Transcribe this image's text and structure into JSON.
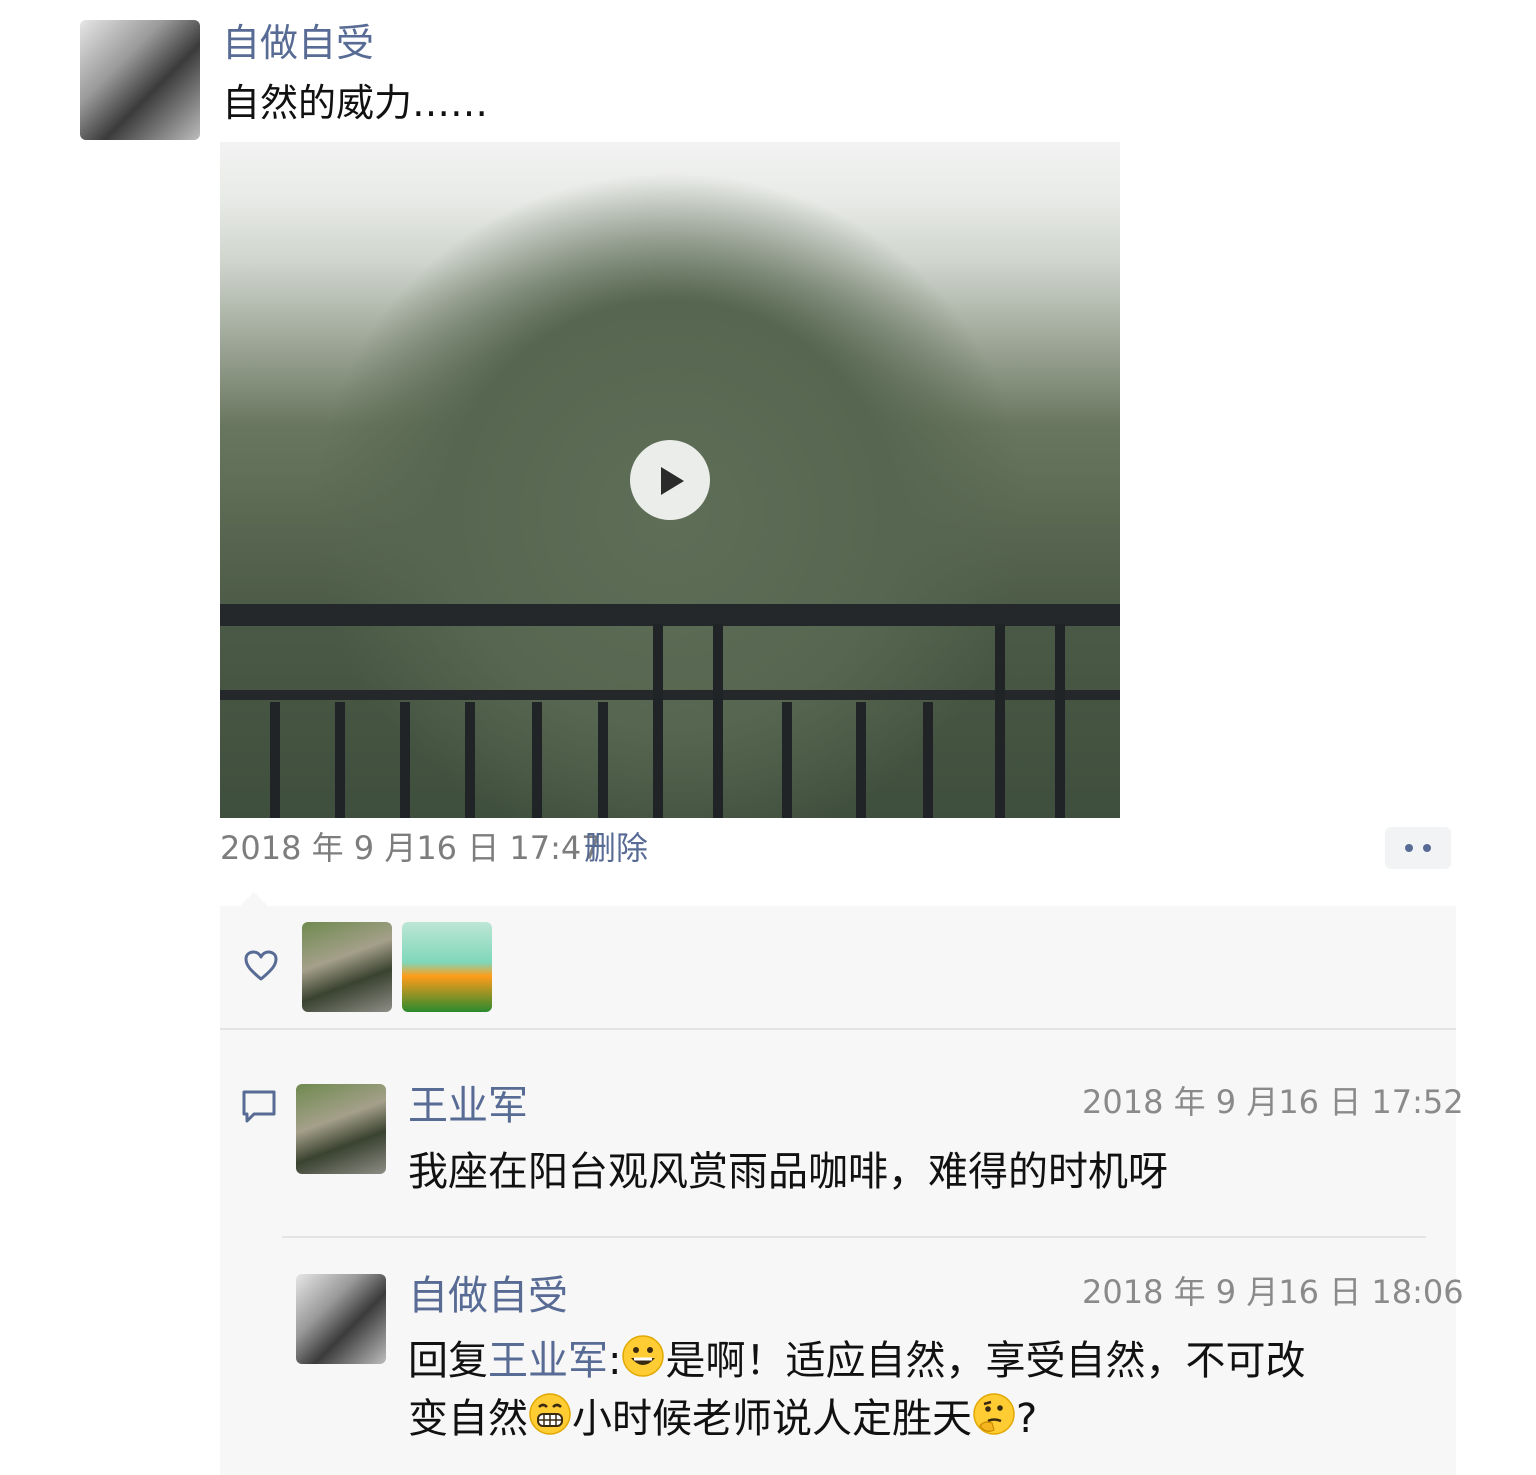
{
  "post": {
    "author": "自做自受",
    "text": "自然的威力……",
    "timestamp": "2018 年 9 月16 日 17:47",
    "delete_label": "删除",
    "more_icon": "more-dots-icon",
    "video": {
      "play_icon": "play-icon"
    }
  },
  "likes": {
    "icon": "heart-icon",
    "users": [
      {
        "avatar": "avatar-wang-yejun"
      },
      {
        "avatar": "avatar-ad"
      }
    ]
  },
  "comments": [
    {
      "author": "王业军",
      "time": "2018 年 9 月16 日 17:52",
      "text": "我座在阳台观风赏雨品咖啡，难得的时机呀"
    },
    {
      "author": "自做自受",
      "time": "2018 年 9 月16 日 18:06",
      "reply_prefix": "回复",
      "reply_to": "王业军",
      "colon": ":",
      "text_part1": "是啊！适应自然，享受自然，不可改",
      "text_part2": "变自然",
      "text_part3": "小时候老师说人定胜天",
      "text_end": "?"
    }
  ],
  "colors": {
    "name_blue": "#576b95",
    "grey_text": "#888888",
    "panel_bg": "#f7f7f7"
  }
}
